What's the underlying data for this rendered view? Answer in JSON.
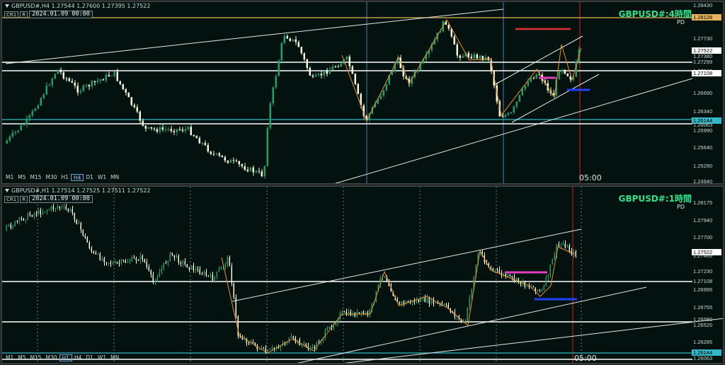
{
  "colors": {
    "background": "#03120f",
    "bull": "#1f9e6c",
    "bear": "#f5f5dc",
    "zigzag": "#e8922a",
    "channel": "#e6e6e6",
    "level": "#ffffff",
    "gold_level": "#e5b45a",
    "cyan_level": "#34b7c4",
    "red_line": "#e03030",
    "magenta_line": "#e040c0",
    "blue_line": "#2040ff",
    "vline_blue": "#4a7fa6",
    "vline_red": "#d02020",
    "title": "#2fe38c"
  },
  "top": {
    "header": "GBPUSD#,H4  1.27544 1.27600 1.27395 1.27522",
    "chip1": "CR1",
    "chip2": "R",
    "date": "2024.01.09 00:00",
    "title": "GBPUSD#:4時間",
    "pd": "PD",
    "time_label": "05:00",
    "timeframes": [
      "M1",
      "M5",
      "M15",
      "M30",
      "H1",
      "H4",
      "D1",
      "W1",
      "MN"
    ],
    "active_tf": "H4",
    "axis_labels": [
      {
        "text": "1.28430",
        "style": "plain",
        "pos": 0.02
      },
      {
        "text": "1.28128",
        "style": "gold",
        "pos": 0.085
      },
      {
        "text": "1.27730",
        "style": "plain",
        "pos": 0.2
      },
      {
        "text": "1.27522",
        "style": "white",
        "pos": 0.268
      },
      {
        "text": "1.27380",
        "style": "plain",
        "pos": 0.298
      },
      {
        "text": "1.27299",
        "style": "plain",
        "pos": 0.33
      },
      {
        "text": "1.27040",
        "style": "plain",
        "pos": 0.38
      },
      {
        "text": "1.27108",
        "style": "white",
        "pos": 0.39
      },
      {
        "text": "1.26690",
        "style": "plain",
        "pos": 0.5
      },
      {
        "text": "1.26340",
        "style": "plain",
        "pos": 0.6
      },
      {
        "text": "1.26144",
        "style": "cyan",
        "pos": 0.65
      },
      {
        "text": "1.26063",
        "style": "plain",
        "pos": 0.675
      },
      {
        "text": "1.25990",
        "style": "plain",
        "pos": 0.705
      },
      {
        "text": "1.25640",
        "style": "plain",
        "pos": 0.8
      },
      {
        "text": "1.25290",
        "style": "plain",
        "pos": 0.9
      },
      {
        "text": "1.24940",
        "style": "plain",
        "pos": 0.985
      }
    ]
  },
  "bottom": {
    "header": "GBPUSD#,H1  1.27514 1.27525 1.27511 1.27522",
    "chip1": "CR1",
    "chip2": "R",
    "date": "2024.01.09 00:00",
    "title": "GBPUSD#:1時間",
    "pd": "PD",
    "time_label": "05:00",
    "timeframes": [
      "M1",
      "M5",
      "M15",
      "M30",
      "H1",
      "H4",
      "D1",
      "W1",
      "MN"
    ],
    "active_tf": "H1",
    "axis_labels": [
      {
        "text": "1.28175",
        "style": "plain",
        "pos": 0.09
      },
      {
        "text": "1.27940",
        "style": "plain",
        "pos": 0.19
      },
      {
        "text": "1.27700",
        "style": "plain",
        "pos": 0.285
      },
      {
        "text": "1.27522",
        "style": "white",
        "pos": 0.37
      },
      {
        "text": "1.27465",
        "style": "plain",
        "pos": 0.39
      },
      {
        "text": "1.27230",
        "style": "plain",
        "pos": 0.48
      },
      {
        "text": "1.27108",
        "style": "plain",
        "pos": 0.535
      },
      {
        "text": "1.26995",
        "style": "plain",
        "pos": 0.58
      },
      {
        "text": "1.26755",
        "style": "plain",
        "pos": 0.68
      },
      {
        "text": "1.26580",
        "style": "plain",
        "pos": 0.75
      },
      {
        "text": "1.26520",
        "style": "plain",
        "pos": 0.78
      },
      {
        "text": "1.26285",
        "style": "plain",
        "pos": 0.875
      },
      {
        "text": "1.26144",
        "style": "cyan",
        "pos": 0.935
      },
      {
        "text": "1.26063",
        "style": "plain",
        "pos": 0.97
      }
    ]
  }
}
